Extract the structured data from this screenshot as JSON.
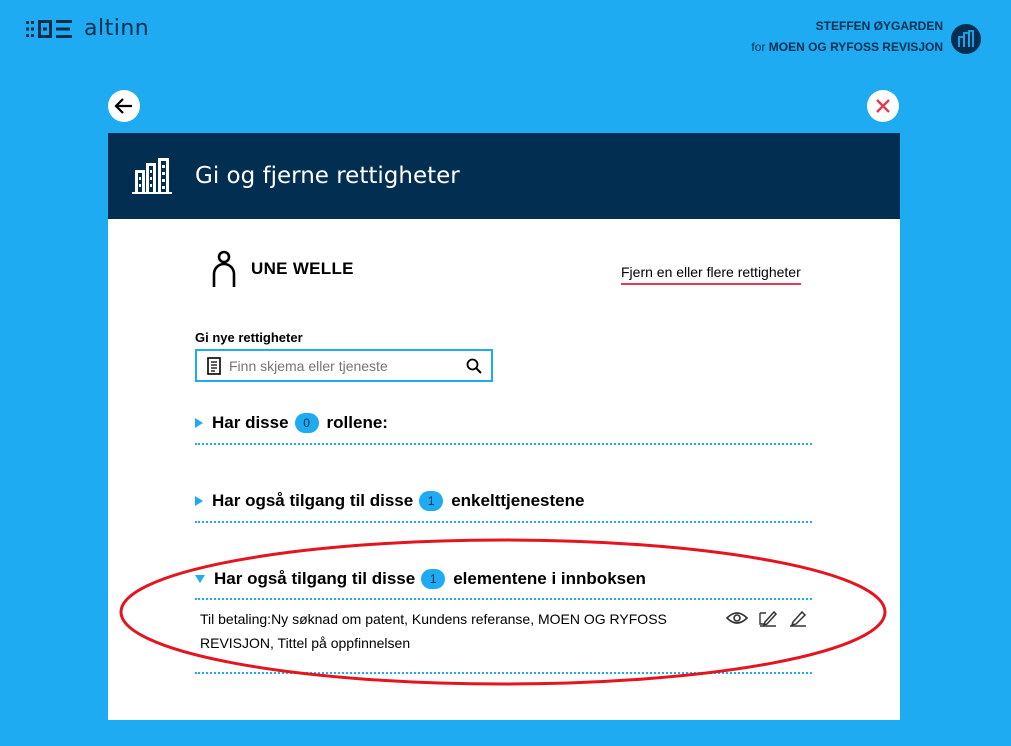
{
  "app": {
    "logo_text": "altinn",
    "brand_color": "#022f51",
    "accent_color": "#1eabf1",
    "alert_color": "#e23b53"
  },
  "user": {
    "name": "STEFFEN ØYGARDEN",
    "org_prefix": "for",
    "org": "MOEN OG RYFOSS REVISJON"
  },
  "nav": {
    "back_icon": "arrow-left-icon",
    "close_icon": "close-icon"
  },
  "modal": {
    "title": "Gi og fjerne rettigheter",
    "header_icon": "building-icon",
    "person_name": "UNE WELLE",
    "person_icon": "person-icon",
    "remove_link": "Fjern en eller flere rettigheter",
    "give_label": "Gi nye rettigheter",
    "search_placeholder": "Finn skjema eller tjeneste",
    "sections": [
      {
        "label_before": "Har disse",
        "count": "0",
        "label_after": "rollene:",
        "expanded": false
      },
      {
        "label_before": "Har også tilgang til disse",
        "count": "1",
        "label_after": "enkelttjenestene",
        "expanded": false
      },
      {
        "label_before": "Har også tilgang til disse",
        "count": "1",
        "label_after": "elementene i innboksen",
        "expanded": true,
        "items": [
          {
            "text": "Til betaling:Ny søknad om patent, Kundens referanse, MOEN OG RYFOSS REVISJON, Tittel på oppfinnelsen",
            "actions": [
              "eye-icon",
              "sign-icon",
              "pencil-icon"
            ]
          }
        ]
      }
    ]
  }
}
